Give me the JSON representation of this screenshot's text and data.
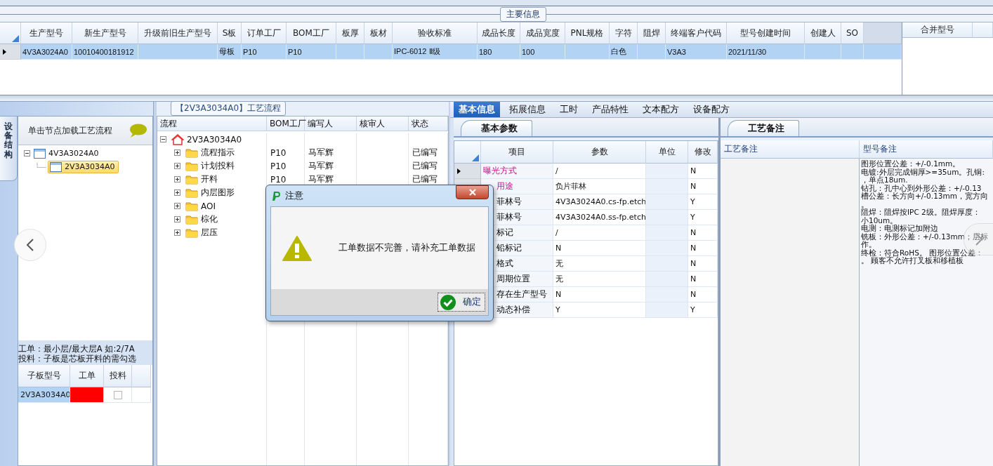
{
  "main_info": {
    "title": "主要信息",
    "columns": [
      "生产型号",
      "新生产型号",
      "升级前旧生产型号",
      "S板",
      "订单工厂",
      "BOM工厂",
      "板厚",
      "板材",
      "验收标准",
      "成品长度",
      "成品宽度",
      "PNL规格",
      "字符",
      "阻焊",
      "终端客户代码",
      "型号创建时间",
      "创建人",
      "SO"
    ],
    "rows": [
      {
        "selected": true,
        "cells": [
          "4V3A3024A0",
          "10010400181912",
          null,
          "母板",
          "P10",
          "P10",
          null,
          null,
          "IPC-6012 Ⅱ级",
          "180",
          "100",
          null,
          "白色",
          null,
          "V3A3",
          "2021/11/30",
          null,
          null
        ]
      }
    ]
  },
  "merge_table": {
    "columns": [
      "合并型号"
    ]
  },
  "side_tabs": [
    {
      "label": "设备结构",
      "selected": true
    }
  ],
  "structure_panel": {
    "hint": "单击节点加载工艺流程",
    "tree": [
      {
        "label": "4V3A3024A0",
        "expanded": true,
        "selected": false,
        "children": [
          {
            "label": "2V3A3034A0",
            "selected": true
          }
        ]
      }
    ],
    "notes": [
      "工单：最小层/最大层A 如:2/7A",
      "投料：子板是芯板开料的需勾选"
    ],
    "sub_boards": {
      "columns": [
        "子板型号",
        "工单",
        "投料"
      ],
      "rows": [
        {
          "board": "2V3A3034A0",
          "selected": true,
          "color": "#ff0000",
          "checked": false
        }
      ]
    }
  },
  "process_flow": {
    "title": "【2V3A3034A0】工艺流程",
    "columns": [
      "流程",
      "BOM工厂",
      "编写人",
      "核审人",
      "状态"
    ],
    "tree": [
      {
        "label": "2V3A3034A0",
        "expanded": true,
        "children": [
          {
            "label": "流程指示",
            "expanded": false,
            "cells": [
              "P10",
              "马军辉",
              null,
              "已编写"
            ]
          },
          {
            "label": "计划投料",
            "expanded": false,
            "cells": [
              "P10",
              "马军辉",
              null,
              "已编写"
            ]
          },
          {
            "label": "开料",
            "expanded": false,
            "cells": [
              "P10",
              "马军辉",
              null,
              "已编写"
            ]
          },
          {
            "label": "内层图形",
            "expanded": false
          },
          {
            "label": "AOI",
            "expanded": false
          },
          {
            "label": "棕化",
            "expanded": false
          },
          {
            "label": "层压",
            "expanded": false
          }
        ]
      }
    ]
  },
  "detail_tabs": [
    {
      "label": "基本信息",
      "selected": true
    },
    {
      "label": "拓展信息",
      "selected": false
    },
    {
      "label": "工时",
      "selected": false
    },
    {
      "label": "产品特性",
      "selected": false
    },
    {
      "label": "文本配方",
      "selected": false
    },
    {
      "label": "设备配方",
      "selected": false
    }
  ],
  "basic_params": {
    "tab": "基本参数",
    "columns": [
      "项目",
      "参数",
      "单位",
      "修改"
    ],
    "rows": [
      {
        "item": "曝光方式",
        "kind": "full",
        "required": true,
        "value": "/",
        "modified": "N",
        "selected": true
      },
      {
        "item": "用途",
        "kind": "cut",
        "required": true,
        "value": "负片菲林",
        "modified": "N"
      },
      {
        "item": "菲林号",
        "kind": "cut",
        "required": false,
        "value": "4V3A3024A0.cs-fp.etch",
        "modified": "Y"
      },
      {
        "item": "菲林号",
        "kind": "cut",
        "required": false,
        "value": "4V3A3024A0.ss-fp.etch",
        "modified": "Y"
      },
      {
        "item": "标记",
        "kind": "cut",
        "required": false,
        "value": "/",
        "modified": "N"
      },
      {
        "item": "铅标记",
        "kind": "cut",
        "required": false,
        "value": "N",
        "modified": "N"
      },
      {
        "item": "格式",
        "kind": "cut",
        "required": false,
        "value": "无",
        "modified": "N"
      },
      {
        "item": "周期位置",
        "kind": "cut",
        "required": false,
        "value": "无",
        "modified": "N"
      },
      {
        "item": "存在生产型号",
        "kind": "cut",
        "required": false,
        "value": "N",
        "modified": "N"
      },
      {
        "item": "动态补偿",
        "kind": "cut",
        "required": false,
        "value": "Y",
        "modified": "Y"
      }
    ]
  },
  "remarks": {
    "tab": "工艺备注",
    "columns": [
      "工艺备注",
      "型号备注"
    ],
    "model_remark": [
      "图形位置公差：+/-0.1mm。",
      "电镀:外层完成铜厚>=35um。孔铜:",
      "，单点18um.",
      "钻孔：孔中心到外形公差：+/-0.13",
      "槽公差：长方向+/-0.13mm，宽方向",
      "。",
      "阻焊：阻焊按IPC 2级。阻焊厚度：",
      "小10um。",
      "电测：电测标记加附边",
      "铣板：外形公差：+/-0.13mm；层标",
      "作。",
      "终检：符合RoHS。 图形位置公差：",
      "。 顾客不允许打叉板和移植板"
    ]
  },
  "dialog": {
    "title": "注意",
    "message": "工单数据不完善，请补充工单数据",
    "button": "确定"
  }
}
